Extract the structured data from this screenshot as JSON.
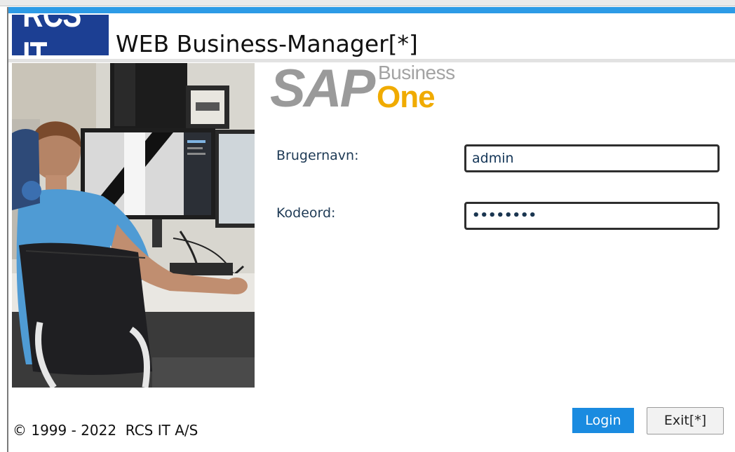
{
  "app": {
    "brand_logo_text": "RCS IT",
    "title": "WEB Business-Manager[*]"
  },
  "product_logo": {
    "sap": "SAP",
    "business": "Business",
    "one": "One"
  },
  "login_form": {
    "username_label": "Brugernavn:",
    "username_value": "admin",
    "password_label": "Kodeord:",
    "password_masked": "••••••••"
  },
  "actions": {
    "login_label": "Login",
    "exit_label": "Exit[*]"
  },
  "footer": {
    "copyright": "© 1999 - 2022  RCS IT A/S"
  },
  "colors": {
    "accent_bar": "#2d9be6",
    "brand_logo_bg": "#1c3f93",
    "login_button": "#1a8be0",
    "sap_grey": "#9a9a9a",
    "sap_one_orange": "#f0ab00"
  },
  "image": {
    "description_name": "office-worker-photo"
  }
}
